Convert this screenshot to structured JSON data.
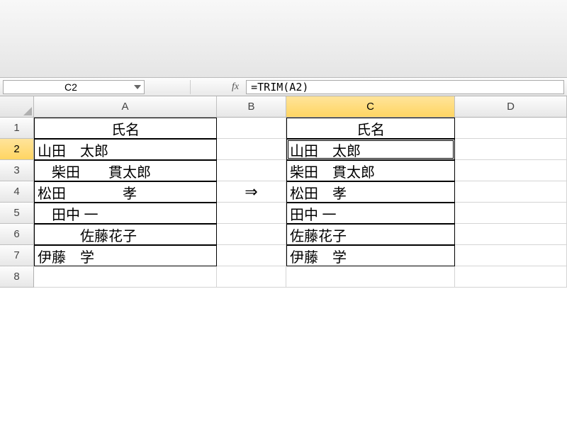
{
  "name_box": {
    "value": "C2"
  },
  "formula_bar": {
    "fx_label": "fx",
    "value": "=TRIM(A2)"
  },
  "columns": [
    "A",
    "B",
    "C",
    "D"
  ],
  "rows": [
    "1",
    "2",
    "3",
    "4",
    "5",
    "6",
    "7",
    "8"
  ],
  "selected_cell_ref": "C2",
  "selected_col_index": 2,
  "selected_row_index": 1,
  "cells": {
    "A": [
      "氏名",
      "山田　太郎",
      "　柴田　　貫太郎",
      "松田　　　　孝",
      "　田中 一",
      "　　　佐藤花子",
      "伊藤　学",
      ""
    ],
    "B": [
      "",
      "",
      "",
      "⇒",
      "",
      "",
      "",
      ""
    ],
    "C": [
      "氏名",
      "山田　太郎",
      "柴田　貫太郎",
      "松田　孝",
      "田中 一",
      "佐藤花子",
      "伊藤　学",
      ""
    ],
    "D": [
      "",
      "",
      "",
      "",
      "",
      "",
      "",
      ""
    ]
  },
  "boxed_ranges": {
    "A": [
      0,
      1,
      2,
      3,
      4,
      5,
      6
    ],
    "C": [
      0,
      1,
      2,
      3,
      4,
      5,
      6
    ]
  }
}
